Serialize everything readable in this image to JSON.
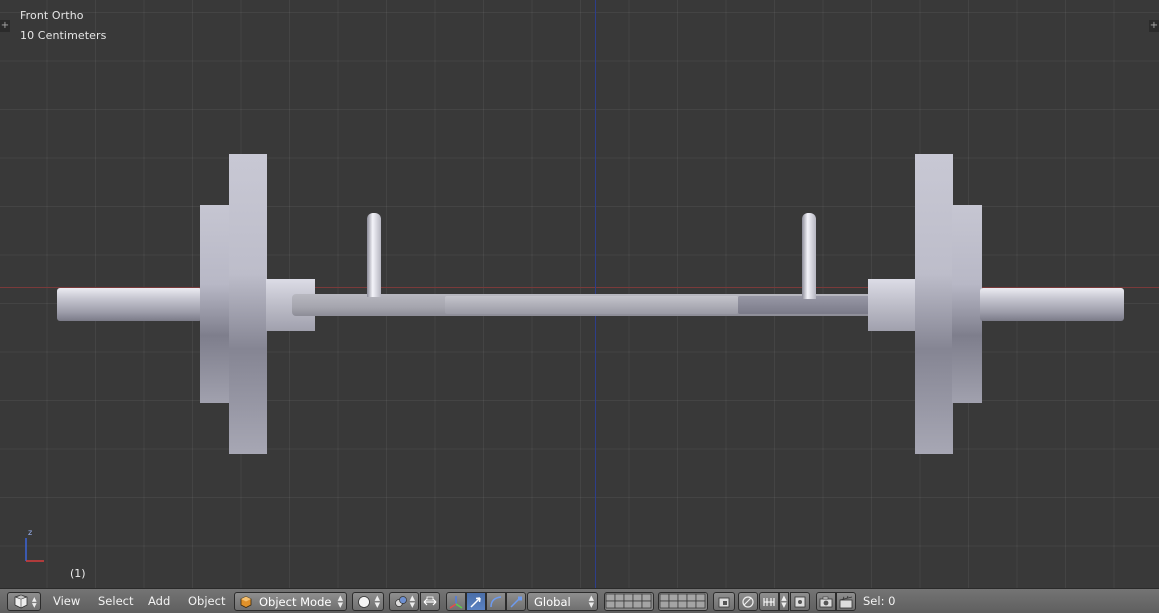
{
  "viewport": {
    "view_name": "Front Ortho",
    "scale_label": "10 Centimeters",
    "frame_label": "(1)",
    "axis_gizmo": {
      "vertical_label": "z"
    }
  },
  "header": {
    "menus": [
      "View",
      "Select",
      "Add",
      "Object"
    ],
    "mode": {
      "label": "Object Mode"
    },
    "orientation": {
      "label": "Global"
    },
    "status": {
      "label": "Sel: 0"
    }
  },
  "icons": {
    "editor_type": "cube-editor-icon",
    "viewport_shading": "solid-sphere-icon",
    "pivot": "pivot-icon",
    "manipulator": "manipulator-axes-icon",
    "translate": "translate-arrow-icon",
    "rotate": "rotate-arc-icon",
    "scale": "scale-icon",
    "layers": "layer-grid-icon",
    "lock_camera": "lock-layers-icon",
    "proportional": "proportional-edit-icon",
    "snap": "magnet-snap-icon",
    "snap_target": "snap-element-icon",
    "render": "render-camera-icon",
    "anim_render": "clapperboard-icon"
  },
  "colors": {
    "x_axis": "#7a3a3a",
    "z_axis": "#2d3e8a",
    "active_tool": "#5a82c2",
    "mode_icon": "#e0912a"
  }
}
